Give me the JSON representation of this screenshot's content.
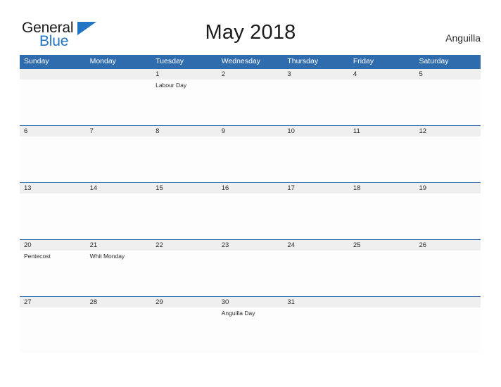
{
  "logo": {
    "word_one": "General",
    "word_two": "Blue",
    "flag_icon": "blue-triangle-flag-icon"
  },
  "header": {
    "title": "May 2018",
    "location": "Anguilla"
  },
  "colors": {
    "header_blue": "#2f6cae",
    "logo_blue": "#2175c4",
    "date_band": "#efefef",
    "cell_background": "#fdfdfd",
    "text": "#2b2b2b"
  },
  "calendar": {
    "weekdays": [
      "Sunday",
      "Monday",
      "Tuesday",
      "Wednesday",
      "Thursday",
      "Friday",
      "Saturday"
    ],
    "weeks": [
      [
        {
          "date": "",
          "event": ""
        },
        {
          "date": "",
          "event": ""
        },
        {
          "date": "1",
          "event": "Labour Day"
        },
        {
          "date": "2",
          "event": ""
        },
        {
          "date": "3",
          "event": ""
        },
        {
          "date": "4",
          "event": ""
        },
        {
          "date": "5",
          "event": ""
        }
      ],
      [
        {
          "date": "6",
          "event": ""
        },
        {
          "date": "7",
          "event": ""
        },
        {
          "date": "8",
          "event": ""
        },
        {
          "date": "9",
          "event": ""
        },
        {
          "date": "10",
          "event": ""
        },
        {
          "date": "11",
          "event": ""
        },
        {
          "date": "12",
          "event": ""
        }
      ],
      [
        {
          "date": "13",
          "event": ""
        },
        {
          "date": "14",
          "event": ""
        },
        {
          "date": "15",
          "event": ""
        },
        {
          "date": "16",
          "event": ""
        },
        {
          "date": "17",
          "event": ""
        },
        {
          "date": "18",
          "event": ""
        },
        {
          "date": "19",
          "event": ""
        }
      ],
      [
        {
          "date": "20",
          "event": "Pentecost"
        },
        {
          "date": "21",
          "event": "Whit Monday"
        },
        {
          "date": "22",
          "event": ""
        },
        {
          "date": "23",
          "event": ""
        },
        {
          "date": "24",
          "event": ""
        },
        {
          "date": "25",
          "event": ""
        },
        {
          "date": "26",
          "event": ""
        }
      ],
      [
        {
          "date": "27",
          "event": ""
        },
        {
          "date": "28",
          "event": ""
        },
        {
          "date": "29",
          "event": ""
        },
        {
          "date": "30",
          "event": "Anguilla Day"
        },
        {
          "date": "31",
          "event": ""
        },
        {
          "date": "",
          "event": ""
        },
        {
          "date": "",
          "event": ""
        }
      ]
    ]
  }
}
